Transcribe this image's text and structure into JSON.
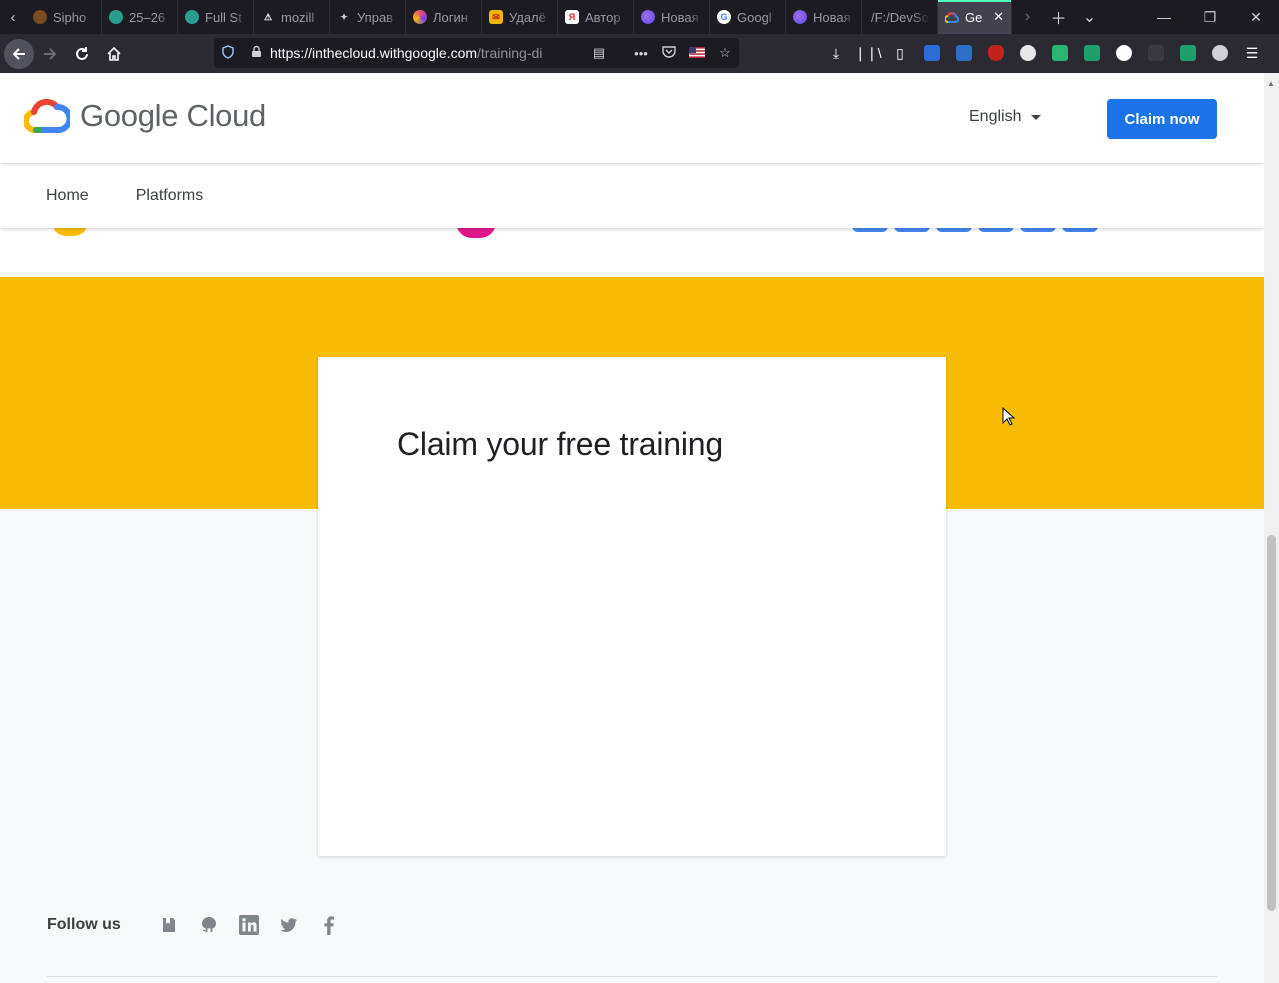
{
  "browser": {
    "tabs": [
      {
        "label": "Sipho",
        "fav_color": "#7a4a20",
        "fav_text": ""
      },
      {
        "label": "25–26",
        "fav_color": "#2a9d8f",
        "fav_text": ""
      },
      {
        "label": "Full St",
        "fav_color": "#2a9d8f",
        "fav_text": ""
      },
      {
        "label": "mozill",
        "fav_color": "#1c1b22",
        "fav_text": "⚠"
      },
      {
        "label": "Управ",
        "fav_color": "#1c1b22",
        "fav_text": "✦"
      },
      {
        "label": "Логин",
        "fav_color": "#7b3fe4",
        "fav_text": ""
      },
      {
        "label": "Удалё",
        "fav_color": "#f2b705",
        "fav_text": "✉"
      },
      {
        "label": "Автор",
        "fav_color": "#ffffff",
        "fav_text": "Я"
      },
      {
        "label": "Новая",
        "fav_color": "#6e5cf0",
        "fav_text": ""
      },
      {
        "label": "Googl",
        "fav_color": "#ffffff",
        "fav_text": "G"
      },
      {
        "label": "Новая",
        "fav_color": "#6e5cf0",
        "fav_text": ""
      },
      {
        "label": "/F:/DevSo",
        "fav_color": "",
        "fav_text": ""
      }
    ],
    "active_tab": {
      "label": "Ge",
      "close": "✕"
    },
    "url_host": "https://inthecloud.withgoogle.com",
    "url_path": "/training-di"
  },
  "header": {
    "logo_text": "Google Cloud",
    "language": "English",
    "claim_button": "Claim now"
  },
  "subnav": {
    "home": "Home",
    "platforms": "Platforms"
  },
  "main": {
    "card_title": "Claim your free training"
  },
  "footer": {
    "follow_label": "Follow us",
    "social_icons": [
      "blog-icon",
      "github-icon",
      "linkedin-icon",
      "twitter-icon",
      "facebook-icon"
    ]
  },
  "colors": {
    "brand_blue": "#1a73e8",
    "band_yellow": "#f9bc05"
  }
}
